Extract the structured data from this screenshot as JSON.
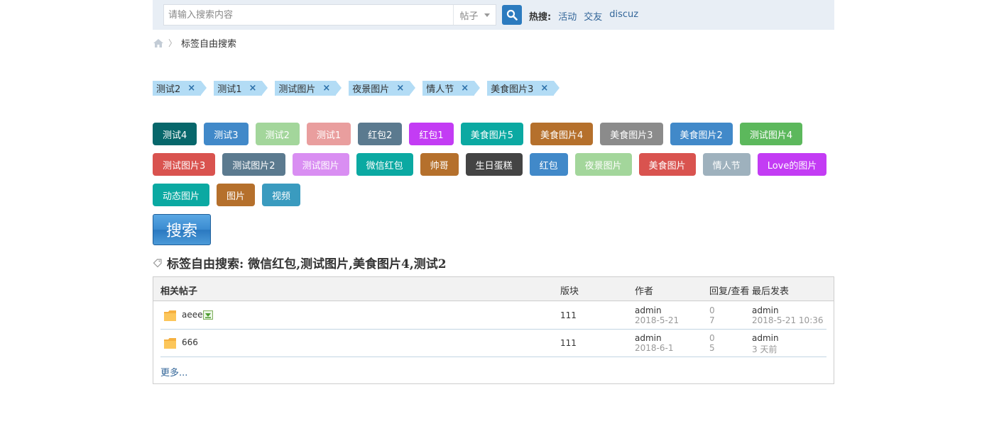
{
  "search": {
    "placeholder": "请输入搜索内容",
    "type_label": "帖子",
    "hot_label": "热搜:",
    "hot_links": [
      "活动",
      "交友",
      "discuz"
    ]
  },
  "breadcrumb": {
    "current": "标签自由搜索"
  },
  "selected_tags": [
    {
      "label": "测试2",
      "remove": "×"
    },
    {
      "label": "测试1",
      "remove": "×"
    },
    {
      "label": "测试图片",
      "remove": "×"
    },
    {
      "label": "夜景图片",
      "remove": "×"
    },
    {
      "label": "情人节",
      "remove": "×"
    },
    {
      "label": "美食图片3",
      "remove": "×"
    }
  ],
  "tags": [
    {
      "label": "测试4",
      "color": "#07676b"
    },
    {
      "label": "测试3",
      "color": "#4189c9"
    },
    {
      "label": "测试2",
      "color": "#a3d69b"
    },
    {
      "label": "测试1",
      "color": "#e99e9e"
    },
    {
      "label": "红包2",
      "color": "#5b7a8f"
    },
    {
      "label": "红包1",
      "color": "#c33cf4"
    },
    {
      "label": "美食图片5",
      "color": "#0ba9a2"
    },
    {
      "label": "美食图片4",
      "color": "#b5702c"
    },
    {
      "label": "美食图片3",
      "color": "#8b8b8b"
    },
    {
      "label": "美食图片2",
      "color": "#4189c9"
    },
    {
      "label": "测试图片4",
      "color": "#5cb85c"
    },
    {
      "label": "测试图片3",
      "color": "#d9534f"
    },
    {
      "label": "测试图片2",
      "color": "#5b7a8f"
    },
    {
      "label": "测试图片",
      "color": "#d98ef2"
    },
    {
      "label": "微信红包",
      "color": "#0ba9a2"
    },
    {
      "label": "帅哥",
      "color": "#b5702c"
    },
    {
      "label": "生日蛋糕",
      "color": "#444444"
    },
    {
      "label": "红包",
      "color": "#4189c9"
    },
    {
      "label": "夜景图片",
      "color": "#a3d69b"
    },
    {
      "label": "美食图片",
      "color": "#d9534f"
    },
    {
      "label": "情人节",
      "color": "#9eb1bd"
    },
    {
      "label": "Love的图片",
      "color": "#c33cf4"
    },
    {
      "label": "动态图片",
      "color": "#0ba9a2"
    },
    {
      "label": "图片",
      "color": "#b5702c"
    },
    {
      "label": "视频",
      "color": "#3a9bbf"
    }
  ],
  "search_button": "搜索",
  "result": {
    "title": "标签自由搜索: 微信红包,测试图片,美食图片4,测试2",
    "columns": {
      "topic": "相关帖子",
      "forum": "版块",
      "author": "作者",
      "replies": "回复/查看",
      "last": "最后发表"
    },
    "rows": [
      {
        "title": "aeee",
        "forum": "111",
        "author": "admin",
        "author_date": "2018-5-21",
        "replies": "0",
        "views": "7",
        "last_user": "admin",
        "last_time": "2018-5-21 10:36"
      },
      {
        "title": "666",
        "forum": "111",
        "author": "admin",
        "author_date": "2018-6-1",
        "replies": "0",
        "views": "5",
        "last_user": "admin",
        "last_time": "3 天前"
      }
    ],
    "more": "更多..."
  }
}
